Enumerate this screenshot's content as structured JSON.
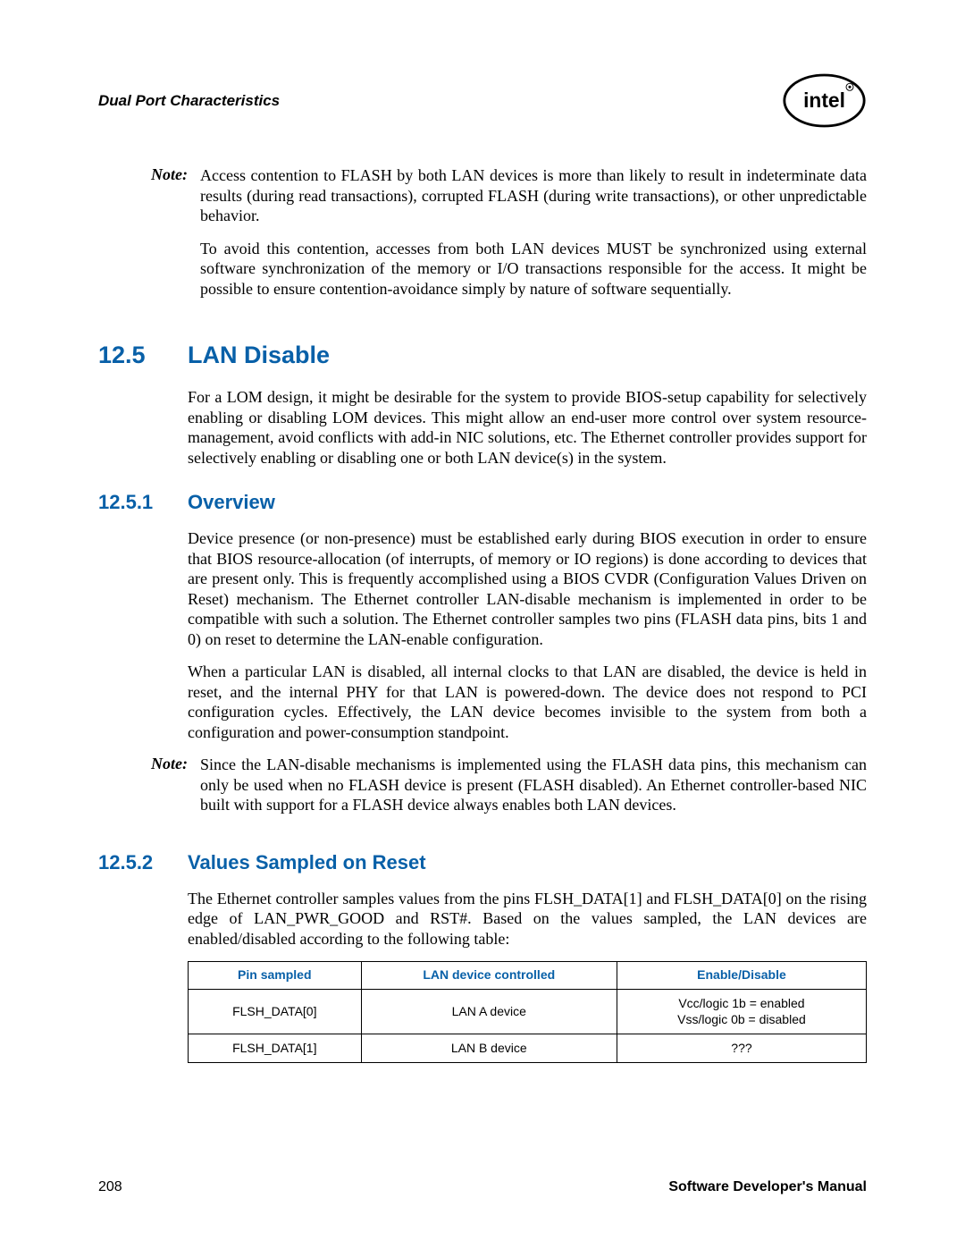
{
  "header": {
    "title": "Dual Port Characteristics",
    "logo_alt": "intel"
  },
  "note1": {
    "label": "Note:",
    "p1": "Access contention to FLASH by both LAN devices is more than likely to result in indeterminate data results (during read transactions), corrupted FLASH (during write transactions), or other unpredictable behavior.",
    "p2": "To avoid this contention, accesses from both LAN devices MUST be synchronized using external software synchronization of the memory or I/O transactions responsible for the access. It might be possible to ensure contention-avoidance simply by nature of software sequentially."
  },
  "sec_12_5": {
    "num": "12.5",
    "title": "LAN Disable",
    "p1": "For a LOM design, it might be desirable for the system to provide BIOS-setup capability for selectively enabling or disabling LOM devices. This might allow an end-user more control over system resource-management, avoid conflicts with add-in NIC solutions, etc. The Ethernet controller provides support for selectively enabling or disabling one or both LAN device(s) in the system."
  },
  "sec_12_5_1": {
    "num": "12.5.1",
    "title": "Overview",
    "p1": "Device presence (or non-presence) must be established early during BIOS execution in order to ensure that BIOS resource-allocation (of interrupts, of memory or IO regions) is done according to devices that are present only. This is frequently accomplished using a BIOS CVDR (Configuration Values Driven on Reset) mechanism. The Ethernet controller LAN-disable mechanism is implemented in order to be compatible with such a solution. The Ethernet controller samples two pins (FLASH data pins, bits 1 and 0) on reset to determine the LAN-enable configuration.",
    "p2": "When a particular LAN is disabled, all internal clocks to that LAN are disabled, the device is held in reset, and the internal PHY for that LAN is powered-down. The device does not respond to PCI configuration cycles. Effectively, the LAN device becomes invisible to the system from both a configuration and power-consumption standpoint."
  },
  "note2": {
    "label": "Note:",
    "p1": "Since the LAN-disable mechanisms is implemented using the FLASH data pins, this mechanism can only be used when no FLASH device is present (FLASH disabled). An Ethernet controller-based NIC built with support for a FLASH device always enables both LAN devices."
  },
  "sec_12_5_2": {
    "num": "12.5.2",
    "title": "Values Sampled on Reset",
    "p1": "The Ethernet controller samples values from the pins FLSH_DATA[1] and FLSH_DATA[0] on the rising edge of LAN_PWR_GOOD and RST#. Based on the values sampled, the LAN devices are enabled/disabled according to the following table:"
  },
  "table": {
    "headers": [
      "Pin sampled",
      "LAN device controlled",
      "Enable/Disable"
    ],
    "rows": [
      [
        "FLSH_DATA[0]",
        "LAN A device",
        "Vcc/logic 1b = enabled\nVss/logic 0b = disabled"
      ],
      [
        "FLSH_DATA[1]",
        "LAN B device",
        "???"
      ]
    ]
  },
  "footer": {
    "page": "208",
    "title": "Software Developer's Manual"
  }
}
